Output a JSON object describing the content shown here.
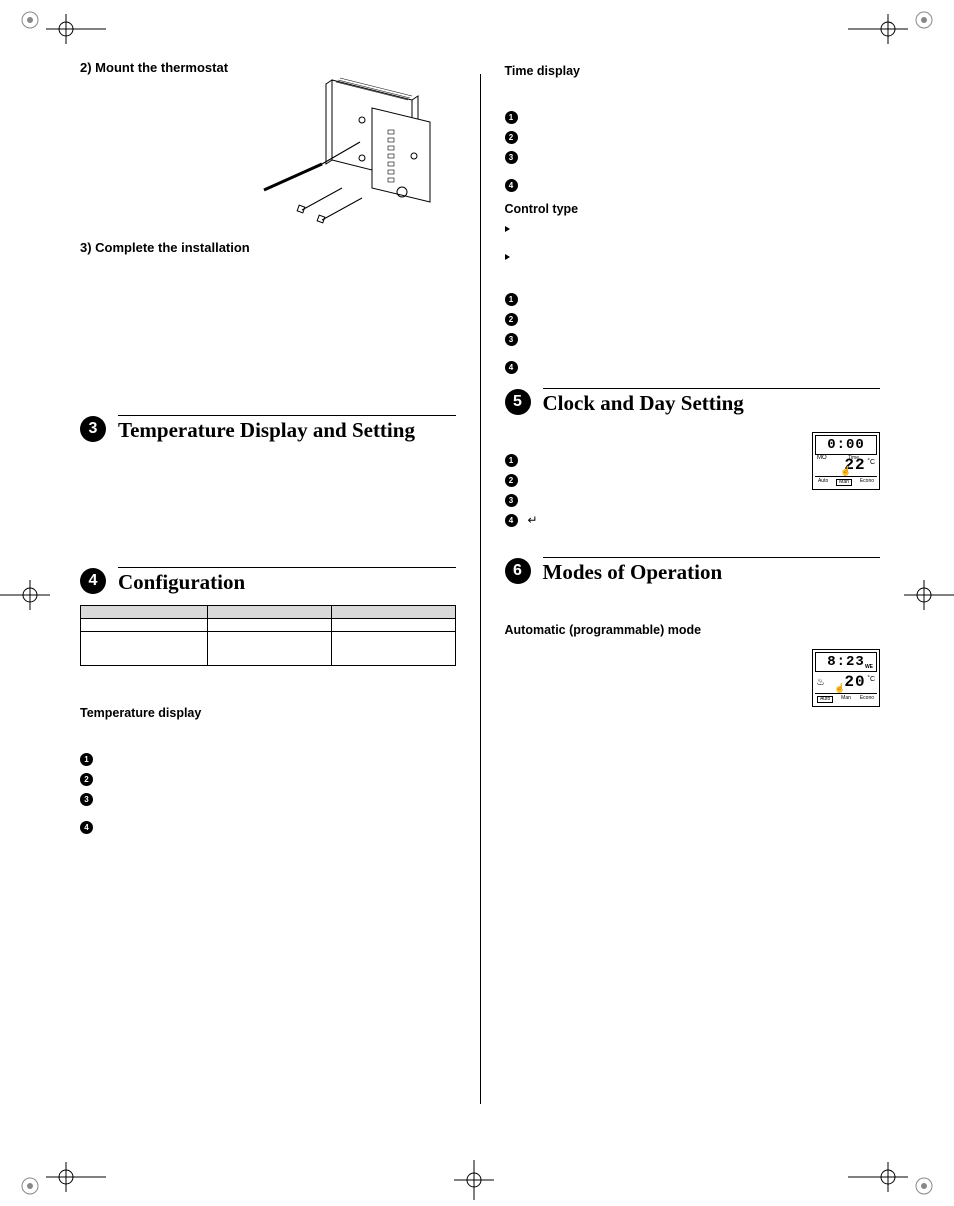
{
  "left": {
    "step2_label": "2) Mount the thermostat",
    "step3_label": "3) Complete the installation",
    "section3_num": "3",
    "section3_title": "Temperature Display and Setting",
    "section4_num": "4",
    "section4_title": "Configuration",
    "config_table": {
      "headers": [
        "",
        "",
        ""
      ],
      "rows": [
        [
          "",
          "",
          ""
        ],
        [
          "",
          "",
          ""
        ]
      ]
    },
    "temp_display_heading": "Temperature display",
    "temp_steps": [
      "1",
      "2",
      "3",
      "4"
    ]
  },
  "right": {
    "time_display_heading": "Time display",
    "time_steps": [
      "1",
      "2",
      "3",
      "4"
    ],
    "control_type_heading": "Control type",
    "control_bullets": [
      "",
      ""
    ],
    "control_steps": [
      "1",
      "2",
      "3",
      "4"
    ],
    "section5_num": "5",
    "section5_title": "Clock and Day Setting",
    "clock_steps": [
      "1",
      "2",
      "3",
      "4"
    ],
    "return_symbol": "↵",
    "section6_num": "6",
    "section6_title": "Modes of Operation",
    "auto_mode_heading": "Automatic (programmable) mode",
    "lcd1": {
      "time": "0:00",
      "day": "MO",
      "tiny": "Time",
      "temp": "22",
      "deg": "˚C",
      "hand": "☝",
      "modes": [
        "Auto",
        "Man",
        "Econo"
      ],
      "boxed_index": 1
    },
    "lcd2": {
      "time": "8:23",
      "day": "WE",
      "heat": "♨",
      "temp": "20",
      "deg": "˚C",
      "hand": "☝",
      "modes": [
        "Auto",
        "Man",
        "Econo"
      ],
      "boxed_index": 0
    }
  }
}
